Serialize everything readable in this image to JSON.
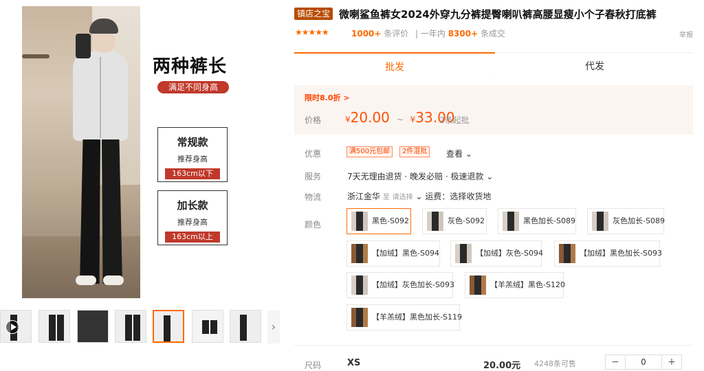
{
  "gallery": {
    "title": "两种裤长",
    "subtitle": "满足不同身高",
    "size1": {
      "name": "常规款",
      "rec": "推荐身高",
      "range": "163cm以下"
    },
    "size2": {
      "name": "加长款",
      "rec": "推荐身高",
      "range": "163cm以上"
    },
    "next_icon": "›"
  },
  "product": {
    "badge": "镇店之宝",
    "title": "微喇鲨鱼裤女2024外穿九分裤提臀喇叭裤高腰显瘦小个子春秋打底裤",
    "stars": "★★★★★",
    "reviews_count": "1000+",
    "reviews_label": "条评价",
    "year_label": "一年内",
    "sold_count": "8300+",
    "sold_label": "条成交",
    "report": "举报"
  },
  "tabs": [
    "批发",
    "代发"
  ],
  "price": {
    "promo": "限时8.0折 >",
    "label": "价格",
    "currency": "¥",
    "low": "20.00",
    "high": "33.00",
    "sep": "~",
    "moq": "2条起批"
  },
  "labels": {
    "discount": "优惠",
    "service": "服务",
    "logistics": "物流",
    "color": "颜色",
    "size": "尺码"
  },
  "discount": {
    "tag1": "满500元包邮",
    "tag2": "2件混批",
    "more": "查看 ⌄"
  },
  "service": "7天无理由退货 · 晚发必赔 · 极速退款 ⌄",
  "logistics": {
    "from": "浙江金华",
    "to": "至",
    "choose": "请选择",
    "fee": "⌄   运费：选择收货地"
  },
  "colors": [
    "黑色-S092",
    "灰色-S092",
    "黑色加长-S089",
    "灰色加长-S089",
    "【加绒】黑色-S094",
    "【加绒】灰色-S094",
    "【加绒】黑色加长-S093",
    "【加绒】灰色加长-S093",
    "【羊羔绒】黑色-S120",
    "【羊羔绒】黑色加长-S119"
  ],
  "size_row": {
    "size": "XS",
    "price": "20.00元",
    "stock": "4248条可售",
    "minus": "−",
    "qty": "0",
    "plus": "+"
  },
  "colors_accent": {
    "orange": "#ff6a00",
    "price": "#ff5000",
    "badge": "#b84c00",
    "red": "#c0392b"
  }
}
